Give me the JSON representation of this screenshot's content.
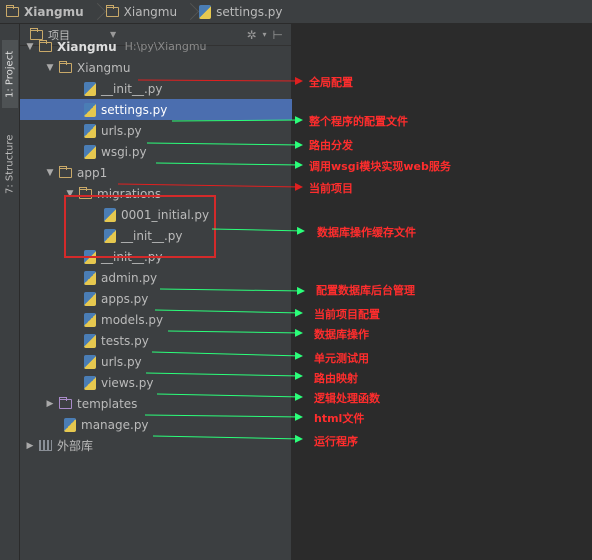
{
  "breadcrumb": {
    "items": [
      "Xiangmu",
      "Xiangmu",
      "settings.py"
    ]
  },
  "toolwindows": {
    "project_tab": "1: Project",
    "structure_tab": "7: Structure"
  },
  "panel": {
    "view_label": "项目",
    "gear_icon": "gear-icon",
    "collapse_icon": "collapse-icon"
  },
  "tree": {
    "root": {
      "name": "Xiangmu",
      "path": "H:\\py\\Xiangmu"
    },
    "xiangmu_pkg": "Xiangmu",
    "xiangmu_init": "__init__.py",
    "settings": "settings.py",
    "urls": "urls.py",
    "wsgi": "wsgi.py",
    "app1": "app1",
    "migrations": "migrations",
    "initial": "0001_initial.py",
    "migrations_init": "__init__.py",
    "app1_init": "__init__.py",
    "admin": "admin.py",
    "apps": "apps.py",
    "models": "models.py",
    "tests": "tests.py",
    "app1_urls": "urls.py",
    "views": "views.py",
    "templates": "templates",
    "manage": "manage.py",
    "external": "外部库"
  },
  "annotations": {
    "global_config": "全局配置",
    "settings_desc": "整个程序的配置文件",
    "urls_desc": "路由分发",
    "wsgi_desc": "调用wsgi模块实现web服务",
    "app_desc": "当前项目",
    "migrations_desc": "数据库操作缓存文件",
    "admin_desc": "配置数据库后台管理",
    "apps_desc": "当前项目配置",
    "models_desc": "数据库操作",
    "tests_desc": "单元测试用",
    "app_urls_desc": "路由映射",
    "views_desc": "逻辑处理函数",
    "templates_desc": "html文件",
    "manage_desc": "运行程序"
  },
  "colors": {
    "red_arrow": "#e02020",
    "green_arrow": "#2bff7a",
    "annotation_text": "#ff2d2d",
    "selection": "#4b6eaf",
    "highlight_box": "#d42a2a"
  }
}
